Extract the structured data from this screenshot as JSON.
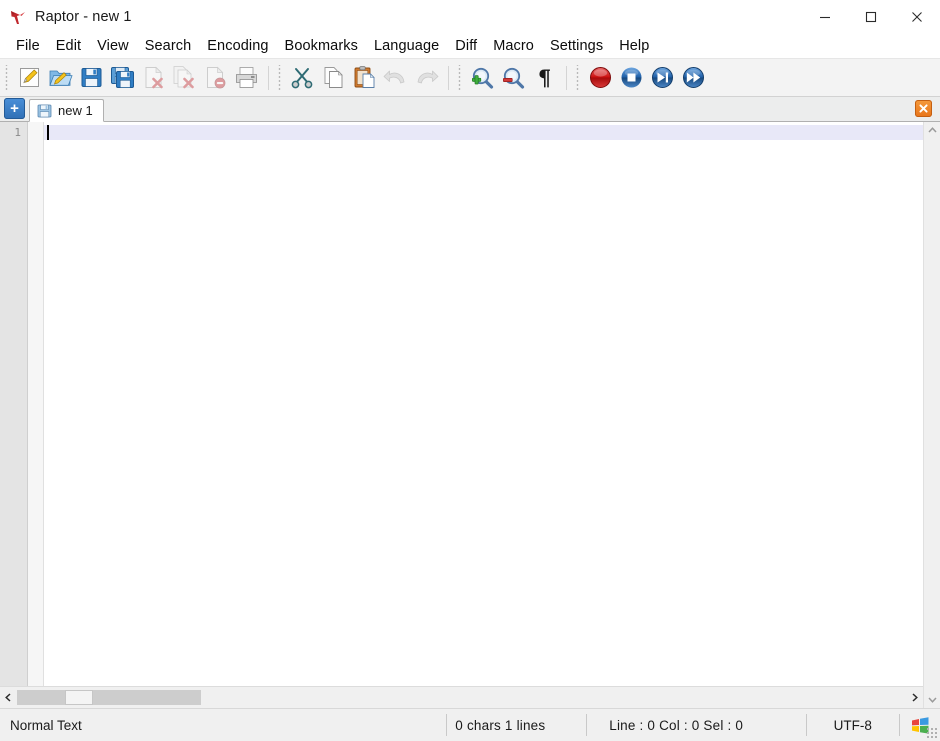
{
  "window": {
    "title": "Raptor - new 1",
    "icon": "raptor-logo-icon",
    "controls": {
      "minimize": "minimize-icon",
      "maximize": "maximize-icon",
      "close": "close-icon"
    }
  },
  "menubar": {
    "items": [
      {
        "label": "File"
      },
      {
        "label": "Edit"
      },
      {
        "label": "View"
      },
      {
        "label": "Search"
      },
      {
        "label": "Encoding"
      },
      {
        "label": "Bookmarks"
      },
      {
        "label": "Language"
      },
      {
        "label": "Diff"
      },
      {
        "label": "Macro"
      },
      {
        "label": "Settings"
      },
      {
        "label": "Help"
      }
    ]
  },
  "toolbar": {
    "groups": [
      {
        "buttons": [
          {
            "name": "new-file-button",
            "icon": "new-document-pencil-icon",
            "tooltip": "New",
            "enabled": true
          },
          {
            "name": "open-file-button",
            "icon": "open-folder-icon",
            "tooltip": "Open",
            "enabled": true
          },
          {
            "name": "save-button",
            "icon": "save-floppy-icon",
            "tooltip": "Save",
            "enabled": true
          },
          {
            "name": "save-all-button",
            "icon": "save-all-floppy-icon",
            "tooltip": "Save All",
            "enabled": true
          },
          {
            "name": "close-file-button",
            "icon": "close-document-icon",
            "tooltip": "Close",
            "enabled": false
          },
          {
            "name": "close-all-files-button",
            "icon": "close-all-documents-icon",
            "tooltip": "Close All",
            "enabled": false
          },
          {
            "name": "delete-file-button",
            "icon": "delete-document-icon",
            "tooltip": "Delete",
            "enabled": false
          },
          {
            "name": "print-button",
            "icon": "printer-icon",
            "tooltip": "Print",
            "enabled": true
          }
        ]
      },
      {
        "buttons": [
          {
            "name": "cut-button",
            "icon": "scissors-icon",
            "tooltip": "Cut",
            "enabled": true
          },
          {
            "name": "copy-button",
            "icon": "copy-pages-icon",
            "tooltip": "Copy",
            "enabled": true
          },
          {
            "name": "paste-button",
            "icon": "paste-clipboard-icon",
            "tooltip": "Paste",
            "enabled": true
          },
          {
            "name": "undo-button",
            "icon": "undo-arrow-icon",
            "tooltip": "Undo",
            "enabled": false
          },
          {
            "name": "redo-button",
            "icon": "redo-arrow-icon",
            "tooltip": "Redo",
            "enabled": false
          }
        ]
      },
      {
        "buttons": [
          {
            "name": "zoom-in-button",
            "icon": "magnifier-plus-icon",
            "tooltip": "Zoom In",
            "enabled": true
          },
          {
            "name": "zoom-out-button",
            "icon": "magnifier-minus-icon",
            "tooltip": "Zoom Out",
            "enabled": true
          },
          {
            "name": "show-formatting-button",
            "icon": "pilcrow-icon",
            "tooltip": "Show All Characters",
            "enabled": true
          }
        ]
      },
      {
        "buttons": [
          {
            "name": "macro-record-button",
            "icon": "record-red-circle-icon",
            "tooltip": "Start Recording",
            "enabled": true
          },
          {
            "name": "macro-stop-button",
            "icon": "stop-square-icon",
            "tooltip": "Stop Recording",
            "enabled": true
          },
          {
            "name": "macro-play-button",
            "icon": "play-once-icon",
            "tooltip": "Playback",
            "enabled": true
          },
          {
            "name": "macro-play-multiple-button",
            "icon": "play-multiple-icon",
            "tooltip": "Run Multiple Times",
            "enabled": true
          }
        ]
      }
    ]
  },
  "tabbar": {
    "add_label": "+",
    "tabs": [
      {
        "label": "new 1",
        "icon": "save-floppy-icon",
        "active": true
      }
    ],
    "close_label": "✕"
  },
  "editor": {
    "line_numbers": [
      "1"
    ],
    "content": "",
    "caret_line": 1
  },
  "scrollbars": {
    "vertical_up": "chevron-up-icon",
    "vertical_down": "chevron-down-icon",
    "horizontal_left": "chevron-left-icon",
    "horizontal_right": "chevron-right-icon"
  },
  "statusbar": {
    "document_type": "Normal Text",
    "chars_lines": "0 chars  1 lines",
    "position": "Line : 0   Col : 0   Sel : 0",
    "encoding": "UTF-8",
    "os_icon": "windows-flag-icon"
  },
  "colors": {
    "titlebar_bg": "#ffffff",
    "toolbar_bg": "#f3f3f3",
    "active_line": "#e8e8f8",
    "tab_add_blue": "#2f6fb5",
    "tab_close_orange": "#e8741a",
    "macro_record_red": "#cc1111",
    "macro_blue": "#1f5fa8"
  }
}
